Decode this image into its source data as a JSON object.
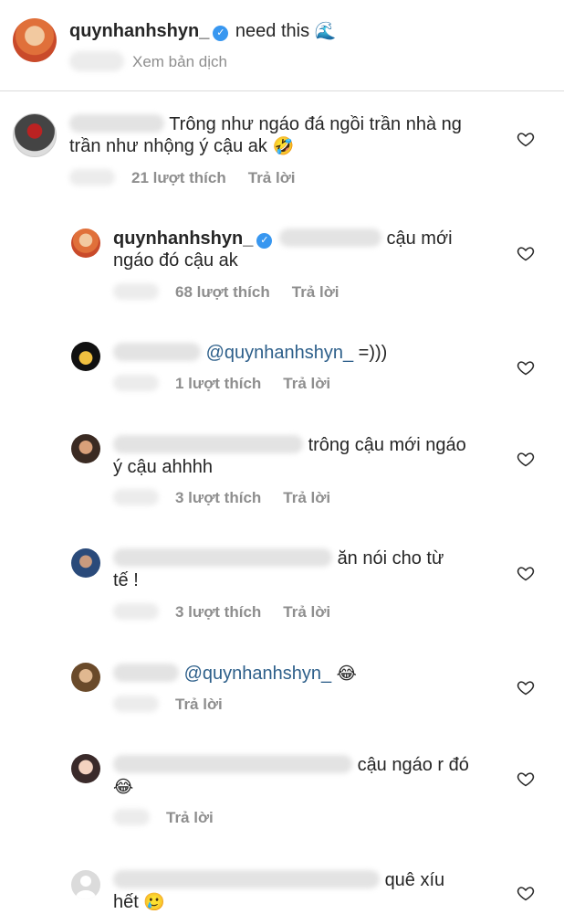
{
  "caption": {
    "username": "quynhanhshyn_",
    "text": "need this",
    "emoji": "🌊",
    "translate": "Xem bản dịch"
  },
  "labels": {
    "reply": "Trả lời"
  },
  "comments": [
    {
      "text_line1": "Trông như ngáo đá ngồi trần nhà ng",
      "text_line2": "trần như nhộng ý cậu ak",
      "emoji": "🤣",
      "likes": "21 lượt thích"
    },
    {
      "username": "quynhanhshyn_",
      "text_line1": "cậu mới",
      "text_line2": "ngáo đó cậu ak",
      "likes": "68 lượt thích"
    },
    {
      "mention": "@quynhanhshyn_",
      "text": "=)))",
      "likes": "1 lượt thích"
    },
    {
      "text_line1": "trông cậu mới ngáo",
      "text_line2": "ý cậu ahhhh",
      "likes": "3 lượt thích"
    },
    {
      "text_line1": "ăn nói cho từ",
      "text_line2": "tế !",
      "likes": "3 lượt thích"
    },
    {
      "mention": "@quynhanhshyn_",
      "emoji": "😂"
    },
    {
      "text_line1": "cậu ngáo r đó",
      "emoji": "😂"
    },
    {
      "text_line1": "quê xíu",
      "text_line2": "hết",
      "emoji": "🥲"
    }
  ]
}
